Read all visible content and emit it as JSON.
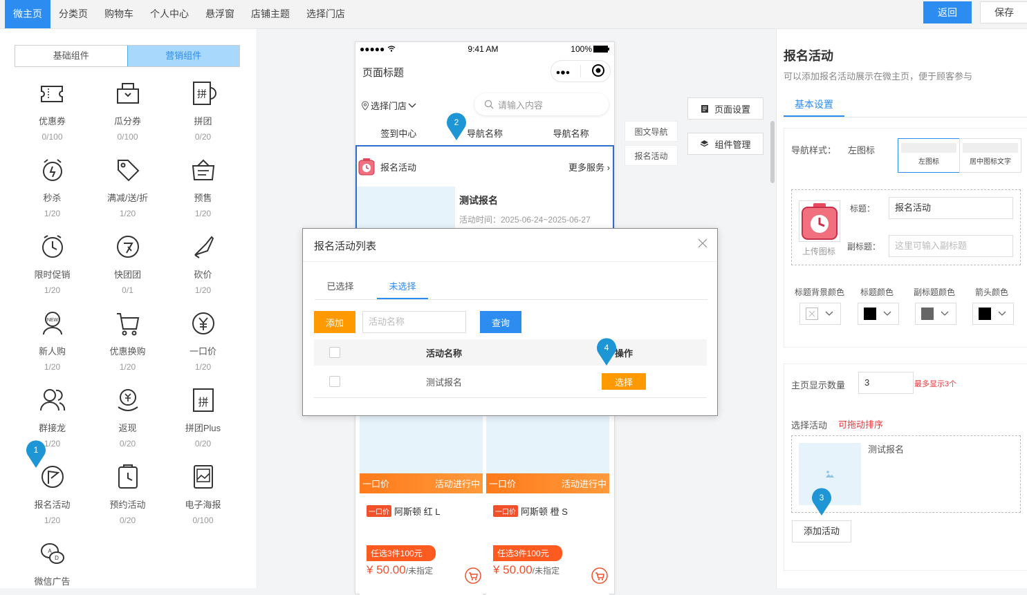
{
  "topnav": {
    "items": [
      "微主页",
      "分类页",
      "购物车",
      "个人中心",
      "悬浮窗",
      "店铺主题",
      "选择门店"
    ],
    "back_label": "返回",
    "save_label": "保存"
  },
  "left": {
    "tabs": [
      "基础组件",
      "营销组件"
    ],
    "components": [
      {
        "name": "优惠券",
        "count": "0/100",
        "icon": "coupon-icon"
      },
      {
        "name": "瓜分券",
        "count": "0/100",
        "icon": "split-coupon-icon"
      },
      {
        "name": "拼团",
        "count": "0/20",
        "icon": "group-buy-icon"
      },
      {
        "name": "秒杀",
        "count": "1/20",
        "icon": "alarm-clock-icon"
      },
      {
        "name": "满减/送/折",
        "count": "1/20",
        "icon": "tag-icon"
      },
      {
        "name": "预售",
        "count": "1/20",
        "icon": "presale-icon"
      },
      {
        "name": "限时促销",
        "count": "1/20",
        "icon": "clock-icon"
      },
      {
        "name": "快团团",
        "count": "0/1",
        "icon": "quick-group-icon"
      },
      {
        "name": "砍价",
        "count": "1/20",
        "icon": "knife-icon"
      },
      {
        "name": "新人购",
        "count": "1/20",
        "icon": "new-user-icon"
      },
      {
        "name": "优惠换购",
        "count": "1/20",
        "icon": "cart-exchange-icon"
      },
      {
        "name": "一口价",
        "count": "1/20",
        "icon": "yen-icon"
      },
      {
        "name": "群接龙",
        "count": "1/20",
        "icon": "group-chain-icon"
      },
      {
        "name": "返现",
        "count": "0/20",
        "icon": "cashback-icon"
      },
      {
        "name": "拼团Plus",
        "count": "0/20",
        "icon": "group-plus-icon"
      },
      {
        "name": "报名活动",
        "count": "1/20",
        "icon": "flag-icon"
      },
      {
        "name": "预约活动",
        "count": "0/20",
        "icon": "appointment-icon"
      },
      {
        "name": "电子海报",
        "count": "0/100",
        "icon": "poster-icon"
      },
      {
        "name": "微信广告",
        "count": "",
        "icon": "wechat-ad-icon"
      }
    ]
  },
  "phone": {
    "status_time": "9:41 AM",
    "battery": "100%",
    "page_title": "页面标题",
    "store_select": "选择门店",
    "search_placeholder": "请输入内容",
    "nav": [
      "签到中心",
      "导航名称",
      "导航名称"
    ],
    "activity_title": "报名活动",
    "activity_more": "更多服务",
    "item_title": "测试报名",
    "item_time": "活动时间：2025-06-24~2025-06-27",
    "products": [
      {
        "bar_left": "一口价",
        "bar_right": "活动进行中",
        "tag": "一口价",
        "name": "阿斯顿 红 L",
        "sale": "任选3件100元",
        "price": "¥ 50.00",
        "unit": "/未指定"
      },
      {
        "bar_left": "一口价",
        "bar_right": "活动进行中",
        "tag": "一口价",
        "name": "阿斯顿 橙 S",
        "sale": "任选3件100元",
        "price": "¥ 50.00",
        "unit": "/未指定"
      }
    ]
  },
  "sidetabs": [
    "图文导航",
    "报名活动"
  ],
  "center_buttons": {
    "page_settings": "页面设置",
    "component_manage": "组件管理"
  },
  "right": {
    "title": "报名活动",
    "desc": "可以添加报名活动展示在微主页，便于顾客参与",
    "tab": "基本设置",
    "nav_style_label": "导航样式：",
    "nav_style_value": "左图标",
    "nav_style_options": [
      "左图标",
      "居中图标文字"
    ],
    "upload_label": "上传图标",
    "title_label": "标题：",
    "title_value": "报名活动",
    "subtitle_label": "副标题：",
    "subtitle_placeholder": "这里可输入副标题",
    "color_labels": [
      "标题背景颜色",
      "标题颜色",
      "副标题颜色",
      "箭头颜色"
    ],
    "colors": [
      "#ffffff",
      "#000000",
      "#666666",
      "#000000"
    ],
    "count_label": "主页显示数量",
    "count_value": "3",
    "count_hint": "最多显示3个",
    "select_label": "选择活动",
    "select_hint": "可拖动排序",
    "selected_item": "测试报名",
    "add_button": "添加活动"
  },
  "modal": {
    "title": "报名活动列表",
    "tabs": [
      "已选择",
      "未选择"
    ],
    "add_button": "添加",
    "search_placeholder": "活动名称",
    "query_button": "查询",
    "col_name": "活动名称",
    "col_op": "操作",
    "rows": [
      {
        "name": "测试报名",
        "action": "选择"
      }
    ]
  },
  "markers": [
    "1",
    "2",
    "3",
    "4"
  ]
}
